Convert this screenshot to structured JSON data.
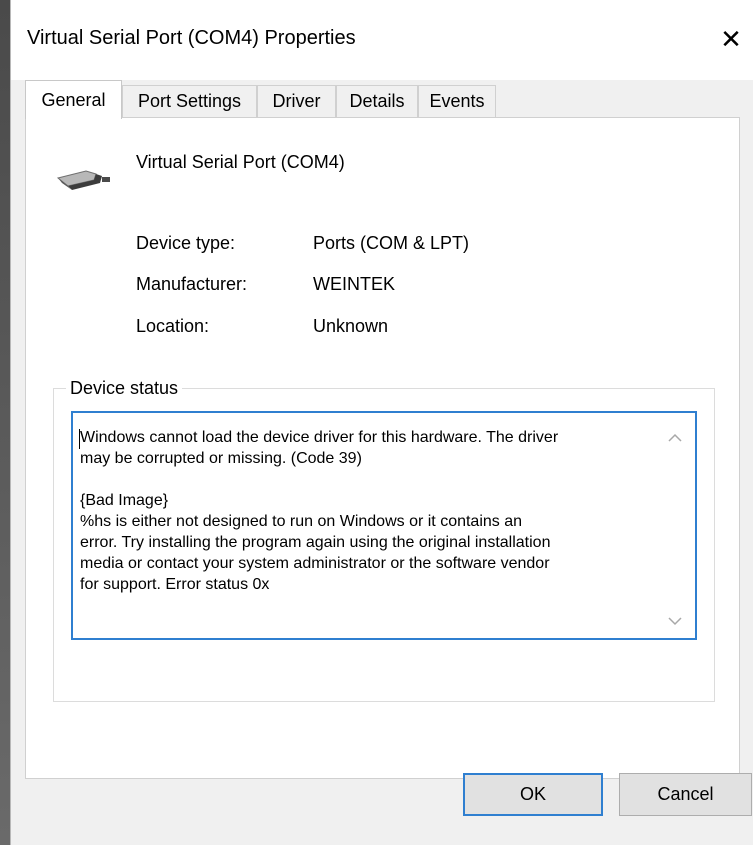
{
  "window": {
    "title": "Virtual Serial Port (COM4) Properties",
    "close_glyph": "✕"
  },
  "tabs": [
    {
      "label": "General",
      "active": true
    },
    {
      "label": "Port Settings",
      "active": false
    },
    {
      "label": "Driver",
      "active": false
    },
    {
      "label": "Details",
      "active": false
    },
    {
      "label": "Events",
      "active": false
    }
  ],
  "device": {
    "name": "Virtual Serial Port (COM4)",
    "icon": "serial-port-icon"
  },
  "properties": [
    {
      "label": "Device type:",
      "value": "Ports (COM & LPT)"
    },
    {
      "label": "Manufacturer:",
      "value": "WEINTEK"
    },
    {
      "label": "Location:",
      "value": "Unknown"
    }
  ],
  "status": {
    "title": "Device status",
    "text": "Windows cannot load the device driver for this hardware. The driver\nmay be corrupted or missing. (Code 39)\n\n{Bad Image}\n%hs is either not designed to run on Windows or it contains an\nerror. Try installing the program again using the original installation\nmedia or contact your system administrator or the software vendor\nfor support. Error status 0x"
  },
  "buttons": {
    "ok": "OK",
    "cancel": "Cancel"
  },
  "colors": {
    "accent": "#2f7fd0",
    "dialog_bg": "#f0f0f0",
    "panel_bg": "#ffffff"
  }
}
